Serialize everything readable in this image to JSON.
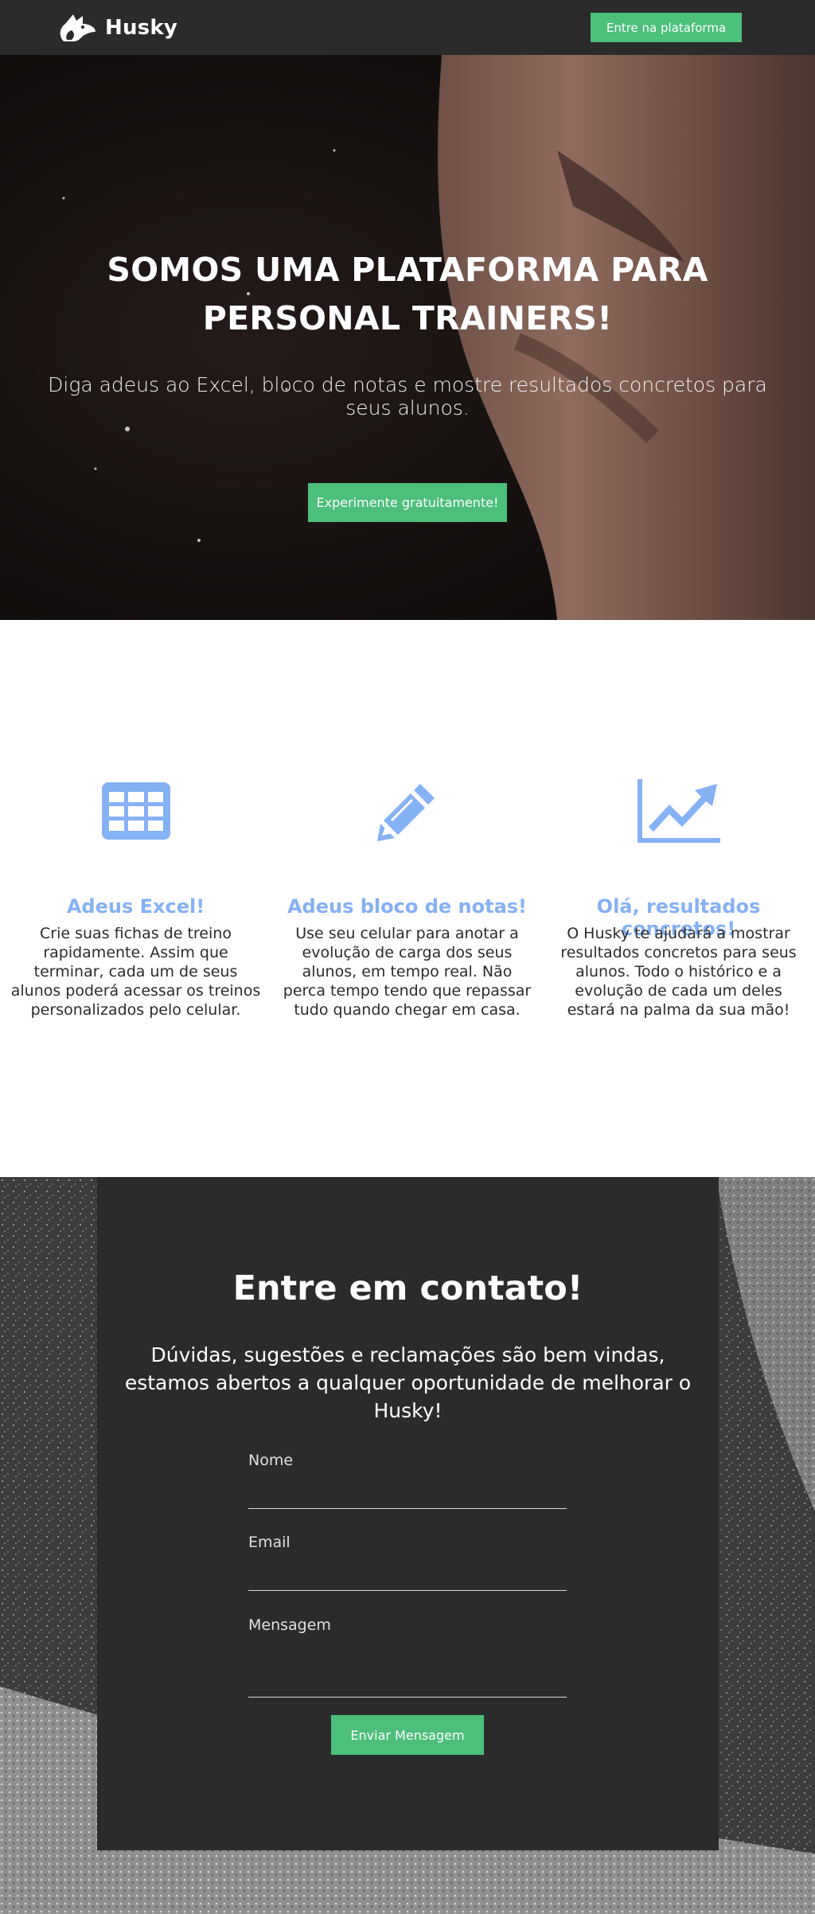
{
  "header": {
    "brand": "Husky",
    "cta_label": "Entre na plataforma"
  },
  "hero": {
    "title_line1": "SOMOS UMA PLATAFORMA PARA",
    "title_line2": "PERSONAL TRAINERS!",
    "subtitle": "Diga adeus ao Excel, bloco de notas e mostre resultados concretos para seus alunos.",
    "cta_label": "Experimente gratuitamente!"
  },
  "features": [
    {
      "icon": "table-icon",
      "title": "Adeus Excel!",
      "text": "Crie suas fichas de treino rapidamente. Assim que terminar, cada um de seus alunos poderá acessar os treinos personalizados pelo celular."
    },
    {
      "icon": "pencil-icon",
      "title": "Adeus bloco de notas!",
      "text": "Use seu celular para anotar a evolução de carga dos seus alunos, em tempo real. Não perca tempo tendo que repassar tudo quando chegar em casa."
    },
    {
      "icon": "line-chart-icon",
      "title": "Olá, resultados concretos!",
      "text": "O Husky te ajudará a mostrar resultados concretos para seus alunos. Todo o histórico e a evolução de cada um deles estará na palma da sua mão!"
    }
  ],
  "contact": {
    "title": "Entre em contato!",
    "subtitle_line1": "Dúvidas, sugestões e reclamações são bem vindas,",
    "subtitle_line2": "estamos abertos a qualquer oportunidade de melhorar o Husky!",
    "fields": {
      "name_label": "Nome",
      "email_label": "Email",
      "message_label": "Mensagem"
    },
    "send_label": "Enviar Mensagem"
  },
  "colors": {
    "nav_bg": "#2b2b2b",
    "accent_green": "#4cbf7a",
    "feature_blue": "#85b1f5",
    "panel_bg": "#2b2b2b"
  }
}
